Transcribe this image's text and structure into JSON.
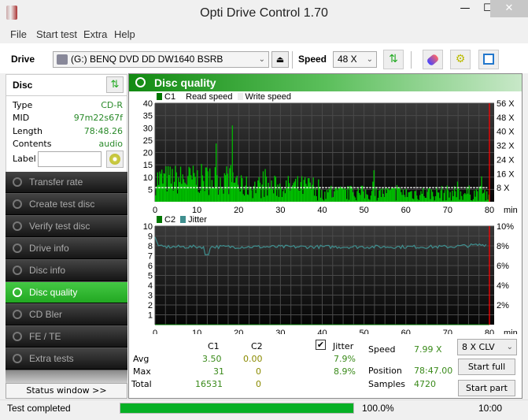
{
  "window": {
    "title": "Opti Drive Control 1.70",
    "min": "—",
    "max": "☐",
    "close": "✕"
  },
  "menu": [
    "File",
    "Start test",
    "Extra",
    "Help"
  ],
  "toolbar": {
    "drive_label": "Drive",
    "drive_value": "(G:)  BENQ DVD DD DW1640 BSRB",
    "eject": "⏏",
    "speed_label": "Speed",
    "speed_value": "48 X",
    "chev": "⌄"
  },
  "disc": {
    "title": "Disc",
    "rows": [
      {
        "label": "Type",
        "value": "CD-R"
      },
      {
        "label": "MID",
        "value": "97m22s67f"
      },
      {
        "label": "Length",
        "value": "78:48.26"
      },
      {
        "label": "Contents",
        "value": "audio"
      }
    ],
    "label_field": {
      "label": "Label",
      "value": ""
    }
  },
  "nav": [
    {
      "label": "Transfer rate",
      "active": false
    },
    {
      "label": "Create test disc",
      "active": false
    },
    {
      "label": "Verify test disc",
      "active": false
    },
    {
      "label": "Drive info",
      "active": false
    },
    {
      "label": "Disc info",
      "active": false
    },
    {
      "label": "Disc quality",
      "active": true
    },
    {
      "label": "CD Bler",
      "active": false
    },
    {
      "label": "FE / TE",
      "active": false
    },
    {
      "label": "Extra tests",
      "active": false
    }
  ],
  "status_window_button": "Status window >>",
  "panel": {
    "title": "Disc quality"
  },
  "colors": {
    "c1": "#00c000",
    "c2": "#007700",
    "jitter": "#3f8f8f",
    "marker": "#ff0000",
    "speed_line": "#ffffff",
    "progress": "#06b025"
  },
  "chart_data": [
    {
      "type": "bar",
      "title": "C1",
      "legend": [
        "C1",
        "Read speed",
        "Write speed"
      ],
      "xlabel": "min",
      "xlim": [
        0,
        80
      ],
      "xticks": [
        0,
        10,
        20,
        30,
        40,
        50,
        60,
        70,
        80
      ],
      "ylim": [
        0,
        40
      ],
      "yticks": [
        5,
        10,
        15,
        20,
        25,
        30,
        35,
        40
      ],
      "y2ticks": [
        "8 X",
        "16 X",
        "24 X",
        "32 X",
        "40 X",
        "48 X",
        "56 X"
      ],
      "grid": true,
      "end_marker_min": 80,
      "read_speed_x": 8,
      "profile": [
        {
          "from": 0,
          "to": 20,
          "mean": 9,
          "spread": 8,
          "max": 27
        },
        {
          "from": 20,
          "to": 38,
          "mean": 6,
          "spread": 6,
          "max": 31
        },
        {
          "from": 38,
          "to": 80,
          "mean": 3.5,
          "spread": 4,
          "max": 15
        }
      ],
      "max_value": 31,
      "max_at_min": 18.5
    },
    {
      "type": "line",
      "title": "C2 / Jitter",
      "legend": [
        "C2",
        "Jitter"
      ],
      "xlabel": "min",
      "xlim": [
        0,
        80
      ],
      "xticks": [
        0,
        10,
        20,
        30,
        40,
        50,
        60,
        70,
        80
      ],
      "ylim": [
        0,
        10
      ],
      "yticks": [
        1,
        2,
        3,
        4,
        5,
        6,
        7,
        8,
        9,
        10
      ],
      "y2ticks": [
        "2%",
        "4%",
        "6%",
        "8%",
        "10%"
      ],
      "grid": true,
      "c2_values": "all 0",
      "jitter_mean": 7.9,
      "jitter_max": 8.9,
      "jitter_start": 8.9,
      "jitter_dip": {
        "at_min": 12.5,
        "value": 7.1
      }
    }
  ],
  "stats": {
    "col_c1": "C1",
    "col_c2": "C2",
    "jitter_label": "Jitter",
    "jitter_checked": "✔",
    "avg_label": "Avg",
    "max_label": "Max",
    "total_label": "Total",
    "avg": {
      "c1": "3.50",
      "c2": "0.00",
      "jitter": "7.9%"
    },
    "max": {
      "c1": "31",
      "c2": "0",
      "jitter": "8.9%"
    },
    "total": {
      "c1": "16531",
      "c2": "0"
    }
  },
  "run": {
    "speed_label": "Speed",
    "speed_value": "7.99 X",
    "position_label": "Position",
    "position_value": "78:47.00",
    "samples_label": "Samples",
    "samples_value": "4720",
    "mode_select": "8 X CLV",
    "start_full": "Start full",
    "start_part": "Start part"
  },
  "statusbar": {
    "text": "Test completed",
    "progress": 100.0,
    "progress_text": "100.0%",
    "time": "10:00"
  }
}
